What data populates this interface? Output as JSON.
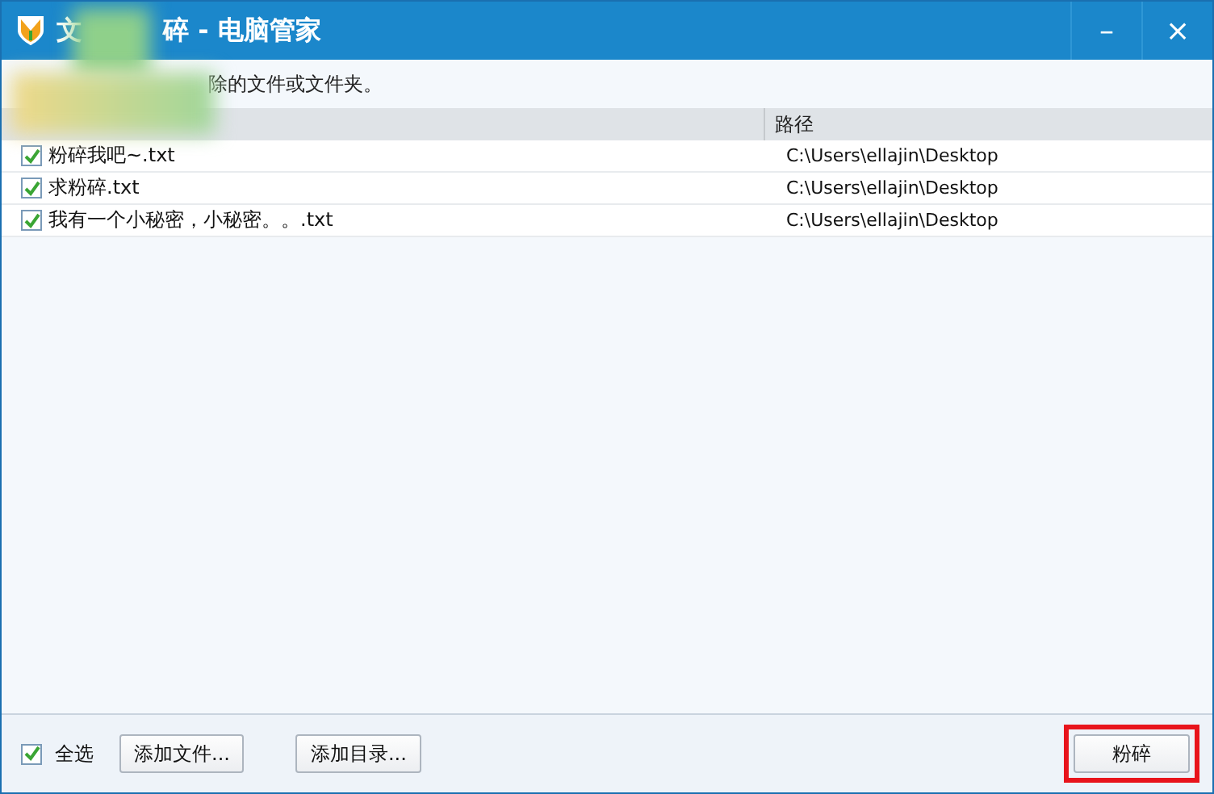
{
  "window": {
    "title_start": "文",
    "title_end": "碎 - 电脑管家",
    "minimize": "–",
    "close": "×"
  },
  "hint": "除的文件或文件夹。",
  "table": {
    "columns": [
      {},
      {
        "label": "路径"
      }
    ],
    "rows": [
      {
        "name": "粉碎我吧~.txt",
        "path": "C:\\Users\\ellajin\\Desktop",
        "checked": true
      },
      {
        "name": "求粉碎.txt",
        "path": "C:\\Users\\ellajin\\Desktop",
        "checked": true
      },
      {
        "name": "我有一个小秘密，小秘密。。.txt",
        "path": "C:\\Users\\ellajin\\Desktop",
        "checked": true
      }
    ]
  },
  "footer": {
    "select_all": {
      "label": "全选",
      "checked": true
    },
    "add_file": "添加文件...",
    "add_folder": "添加目录...",
    "shred": {
      "label": "粉碎",
      "highlighted": true
    }
  }
}
